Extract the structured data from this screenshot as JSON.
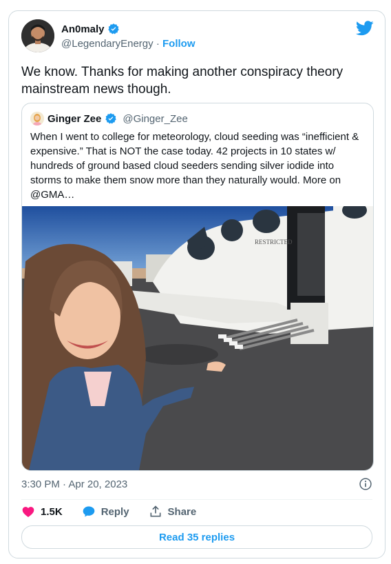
{
  "author": {
    "name": "An0maly",
    "handle": "@LegendaryEnergy",
    "separator": "·",
    "follow_label": "Follow"
  },
  "tweet": {
    "text": "We know. Thanks for making another conspiracy theory\nmainstream news though."
  },
  "quoted": {
    "name": "Ginger Zee",
    "handle": "@Ginger_Zee",
    "text": "When I went to college for meteorology, cloud seeding was “inefficient & expensive.” That is NOT the case today. 42 projects in 10 states w/ hundreds of ground based cloud seeders sending silver iodide into storms to make them snow more than they naturally would. More on @GMA…",
    "photo_caption": "RESTRICTED"
  },
  "meta": {
    "timestamp": "3:30 PM · Apr 20, 2023"
  },
  "actions": {
    "like_count": "1.5K",
    "reply_label": "Reply",
    "share_label": "Share"
  },
  "footer": {
    "read_replies_label": "Read 35 replies"
  },
  "colors": {
    "accent": "#1d9bf0",
    "like": "#f91880",
    "muted": "#536471"
  },
  "icons": [
    "verified-badge-icon",
    "twitter-bird-icon",
    "info-icon",
    "heart-icon",
    "reply-bubble-icon",
    "share-icon"
  ]
}
